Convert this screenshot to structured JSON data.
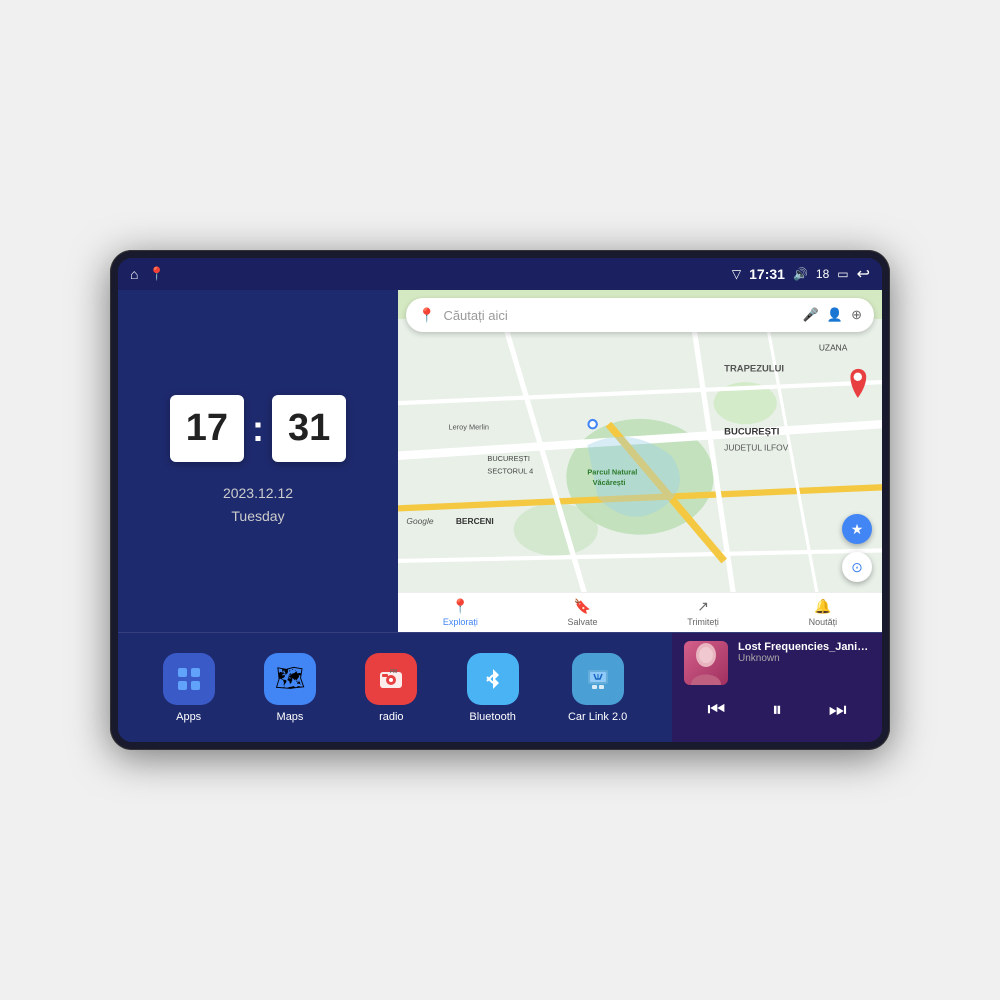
{
  "device": {
    "screen_bg": "#1e2a6e"
  },
  "status_bar": {
    "time": "17:31",
    "signal_icon": "▽",
    "volume_icon": "🔊",
    "battery_level": "18",
    "battery_icon": "🔋",
    "back_icon": "↩",
    "home_icon": "⌂",
    "nav_icon": "📍"
  },
  "clock": {
    "hour": "17",
    "minute": "31",
    "date": "2023.12.12",
    "day": "Tuesday"
  },
  "map": {
    "search_placeholder": "Căutați aici",
    "nav_items": [
      {
        "label": "Explorați",
        "icon": "📍",
        "active": true
      },
      {
        "label": "Salvate",
        "icon": "🔖",
        "active": false
      },
      {
        "label": "Trimiteți",
        "icon": "↗",
        "active": false
      },
      {
        "label": "Noutăți",
        "icon": "🔔",
        "active": false
      }
    ],
    "labels": {
      "trapezului": "TRAPEZULUI",
      "bucuresti": "BUCUREȘTI",
      "ilfov": "JUDEȚUL ILFOV",
      "berceni": "BERCENI",
      "sector4": "BUCUREȘTI\nSECTORUL 4",
      "parcul": "Parcul Natural Văcărești",
      "leroy": "Leroy Merlin",
      "uzana": "UZANA"
    }
  },
  "apps": [
    {
      "id": "apps",
      "label": "Apps",
      "icon": "⊞",
      "bg_class": "app-icon-apps"
    },
    {
      "id": "maps",
      "label": "Maps",
      "icon": "🗺",
      "bg_class": "app-icon-maps"
    },
    {
      "id": "radio",
      "label": "radio",
      "icon": "📻",
      "bg_class": "app-icon-radio"
    },
    {
      "id": "bluetooth",
      "label": "Bluetooth",
      "icon": "𝔹",
      "bg_class": "app-icon-bt"
    },
    {
      "id": "carlink",
      "label": "Car Link 2.0",
      "icon": "📱",
      "bg_class": "app-icon-carlink"
    }
  ],
  "music": {
    "title": "Lost Frequencies_Janieck Devy-...",
    "artist": "Unknown",
    "prev_icon": "⏮",
    "play_icon": "⏸",
    "next_icon": "⏭"
  }
}
